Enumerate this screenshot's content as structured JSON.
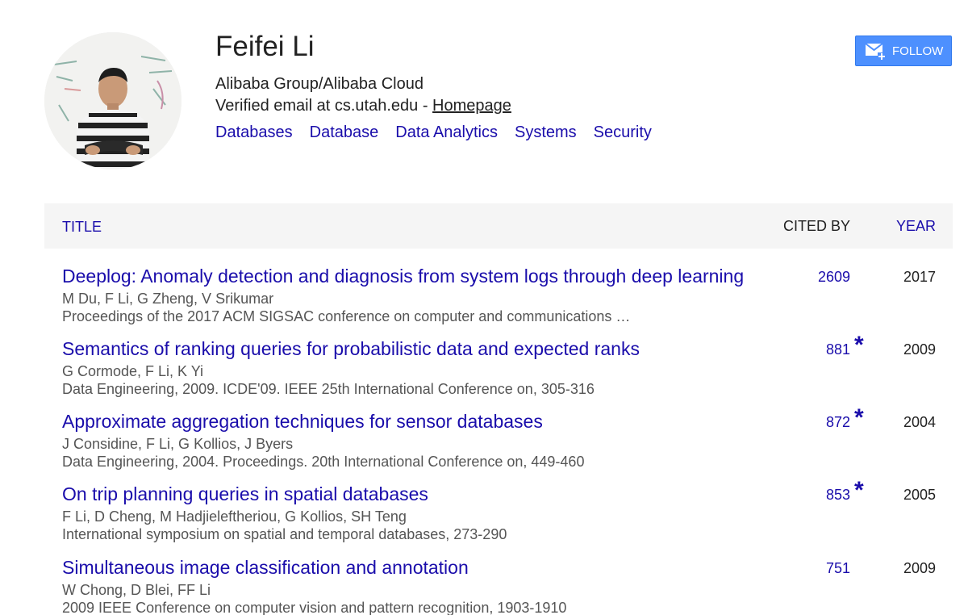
{
  "profile": {
    "name": "Feifei Li",
    "affiliation": "Alibaba Group/Alibaba Cloud",
    "email_text": "Verified email at cs.utah.edu - ",
    "homepage_label": "Homepage",
    "interests": [
      "Databases",
      "Database",
      "Data Analytics",
      "Systems",
      "Security"
    ],
    "follow_label": "FOLLOW"
  },
  "table": {
    "headers": {
      "title": "TITLE",
      "cited_by": "CITED BY",
      "year": "YEAR"
    },
    "rows": [
      {
        "title": "Deeplog: Anomaly detection and diagnosis from system logs through deep learning",
        "authors": "M Du, F Li, G Zheng, V Srikumar",
        "venue": "Proceedings of the 2017 ACM SIGSAC conference on computer and communications …",
        "cited_by": "2609",
        "star": "",
        "year": "2017"
      },
      {
        "title": "Semantics of ranking queries for probabilistic data and expected ranks",
        "authors": "G Cormode, F Li, K Yi",
        "venue": "Data Engineering, 2009. ICDE'09. IEEE 25th International Conference on, 305-316",
        "cited_by": "881",
        "star": "*",
        "year": "2009"
      },
      {
        "title": "Approximate aggregation techniques for sensor databases",
        "authors": "J Considine, F Li, G Kollios, J Byers",
        "venue": "Data Engineering, 2004. Proceedings. 20th International Conference on, 449-460",
        "cited_by": "872",
        "star": "*",
        "year": "2004"
      },
      {
        "title": "On trip planning queries in spatial databases",
        "authors": "F Li, D Cheng, M Hadjieleftheriou, G Kollios, SH Teng",
        "venue": "International symposium on spatial and temporal databases, 273-290",
        "cited_by": "853",
        "star": "*",
        "year": "2005"
      },
      {
        "title": "Simultaneous image classification and annotation",
        "authors": "W Chong, D Blei, FF Li",
        "venue": "2009 IEEE Conference on computer vision and pattern recognition, 1903-1910",
        "cited_by": "751",
        "star": "",
        "year": "2009"
      }
    ]
  },
  "colors": {
    "link": "#1a0dab",
    "follow_button": "#4d90fe",
    "header_bg": "#f5f5f5",
    "meta_text": "#555555"
  },
  "icons": {
    "follow": "mail-plus-icon",
    "avatar": "profile-photo"
  }
}
